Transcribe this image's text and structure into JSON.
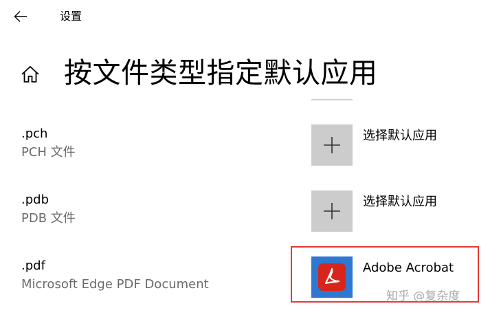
{
  "window": {
    "title": "设置",
    "back_icon": "arrow-left-icon"
  },
  "page": {
    "home_icon": "home-icon",
    "title": "按文件类型指定默认应用"
  },
  "rows": [
    {
      "ext": ".pch",
      "desc": "PCH 文件",
      "app": {
        "label": "选择默认应用",
        "icon": "plus-icon"
      }
    },
    {
      "ext": ".pdb",
      "desc": "PDB 文件",
      "app": {
        "label": "选择默认应用",
        "icon": "plus-icon"
      }
    },
    {
      "ext": ".pdf",
      "desc": "Microsoft Edge PDF Document",
      "app": {
        "label": "Adobe Acrobat",
        "icon": "adobe-acrobat-icon"
      }
    }
  ],
  "colors": {
    "tile_gray": "#cccccc",
    "acrobat_tile": "#2f78d1",
    "acrobat_red": "#d7251c",
    "highlight": "#e53935",
    "secondary_text": "#6b6b6b"
  },
  "watermark": "知乎 @复杂度"
}
